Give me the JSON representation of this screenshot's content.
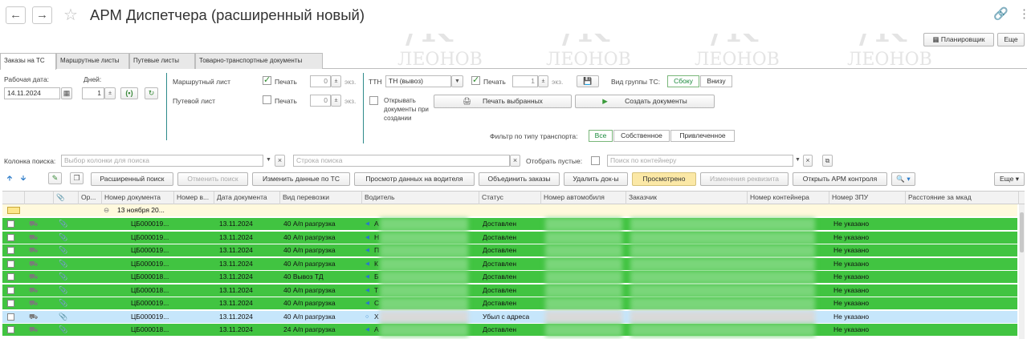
{
  "window": {
    "title": "АРМ Диспетчера (расширенный новый)",
    "planner_label": "Планировщик",
    "more_label": "Еще"
  },
  "tabs": [
    "Заказы на ТС",
    "Маршрутные листы",
    "Путевые листы",
    "Товарно-транспортные документы"
  ],
  "filters": {
    "work_date_label": "Рабочая дата:",
    "work_date": "14.11.2024",
    "days_label": "Дней:",
    "days_value": "1",
    "route_sheet_label": "Маршрутный лист",
    "waybill_label": "Путевой лист",
    "print_label": "Печать",
    "copies_route": "0",
    "copies_waybill": "0",
    "copies_label": "экз.",
    "ttn_label": "ТТН",
    "ttn_value": "ТН (вывоз)",
    "ttn_copies": "1",
    "group_view_label": "Вид группы ТС:",
    "group_side": "Сбоку",
    "group_bottom": "Внизу",
    "open_docs_label": "Открывать документы при создании",
    "print_selected": "Печать выбранных",
    "create_docs": "Создать документы",
    "transport_filter_label": "Фильтр по типу транспорта:",
    "transport_all": "Все",
    "transport_own": "Собственное",
    "transport_hired": "Привлеченное"
  },
  "search": {
    "column_label": "Колонка поиска:",
    "column_placeholder": "Выбор колонки для поиска",
    "string_placeholder": "Строка поиска",
    "show_empty_label": "Отобрать пустые:",
    "container_placeholder": "Поиск по контейнеру"
  },
  "toolbar": {
    "extended_search": "Расширенный поиск",
    "cancel_search": "Отменить поиск",
    "edit_ts": "Изменить данные по ТС",
    "view_driver": "Просмотр данных на водителя",
    "merge_orders": "Объединить заказы",
    "delete_docs": "Удалить док-ы",
    "reviewed": "Просмотрено",
    "change_requisite": "Изменения реквизита",
    "open_control": "Открыть АРМ контроля",
    "more": "Еще"
  },
  "table": {
    "headers": [
      "Ор...",
      "Номер документа",
      "Номер в...",
      "Дата документа",
      "Вид перевозки",
      "Водитель",
      "Статус",
      "Номер автомобиля",
      "Заказчик",
      "Номер контейнера",
      "Номер ЗПУ",
      "Расстояние за мкад"
    ],
    "group_label": "13 ноября 20...",
    "rows": [
      {
        "doc": "ЦБ000019...",
        "date": "13.11.2024",
        "type": "40 А/п разгрузка",
        "driver": "А",
        "status": "Доставлен",
        "zpu": "Не указано",
        "style": "green"
      },
      {
        "doc": "ЦБ000019...",
        "date": "13.11.2024",
        "type": "40 А/п разгрузка",
        "driver": "Н",
        "status": "Доставлен",
        "zpu": "Не указано",
        "style": "green"
      },
      {
        "doc": "ЦБ000019...",
        "date": "13.11.2024",
        "type": "40 А/п разгрузка",
        "driver": "П",
        "status": "Доставлен",
        "zpu": "Не указано",
        "style": "green"
      },
      {
        "doc": "ЦБ000019...",
        "date": "13.11.2024",
        "type": "40 А/п разгрузка",
        "driver": "К",
        "status": "Доставлен",
        "zpu": "Не указано",
        "style": "green"
      },
      {
        "doc": "ЦБ000018...",
        "date": "13.11.2024",
        "type": "40 Вывоз ТД",
        "driver": "Б",
        "status": "Доставлен",
        "zpu": "Не указано",
        "style": "green"
      },
      {
        "doc": "ЦБ000018...",
        "date": "13.11.2024",
        "type": "40 А/п разгрузка",
        "driver": "Т",
        "status": "Доставлен",
        "zpu": "Не указано",
        "style": "green"
      },
      {
        "doc": "ЦБ000019...",
        "date": "13.11.2024",
        "type": "40 А/п разгрузка",
        "driver": "С",
        "status": "Доставлен",
        "zpu": "Не указано",
        "style": "green"
      },
      {
        "doc": "ЦБ000019...",
        "date": "13.11.2024",
        "type": "40 А/п разгрузка",
        "driver": "Х",
        "status": "Убыл с адреса",
        "zpu": "Не указано",
        "style": "blue"
      },
      {
        "doc": "ЦБ000018...",
        "date": "13.11.2024",
        "type": "24 А/п разгрузка",
        "driver": "А",
        "status": "Доставлен",
        "zpu": "Не указано",
        "style": "green"
      }
    ]
  },
  "watermark": "ЛЕОНОВ"
}
